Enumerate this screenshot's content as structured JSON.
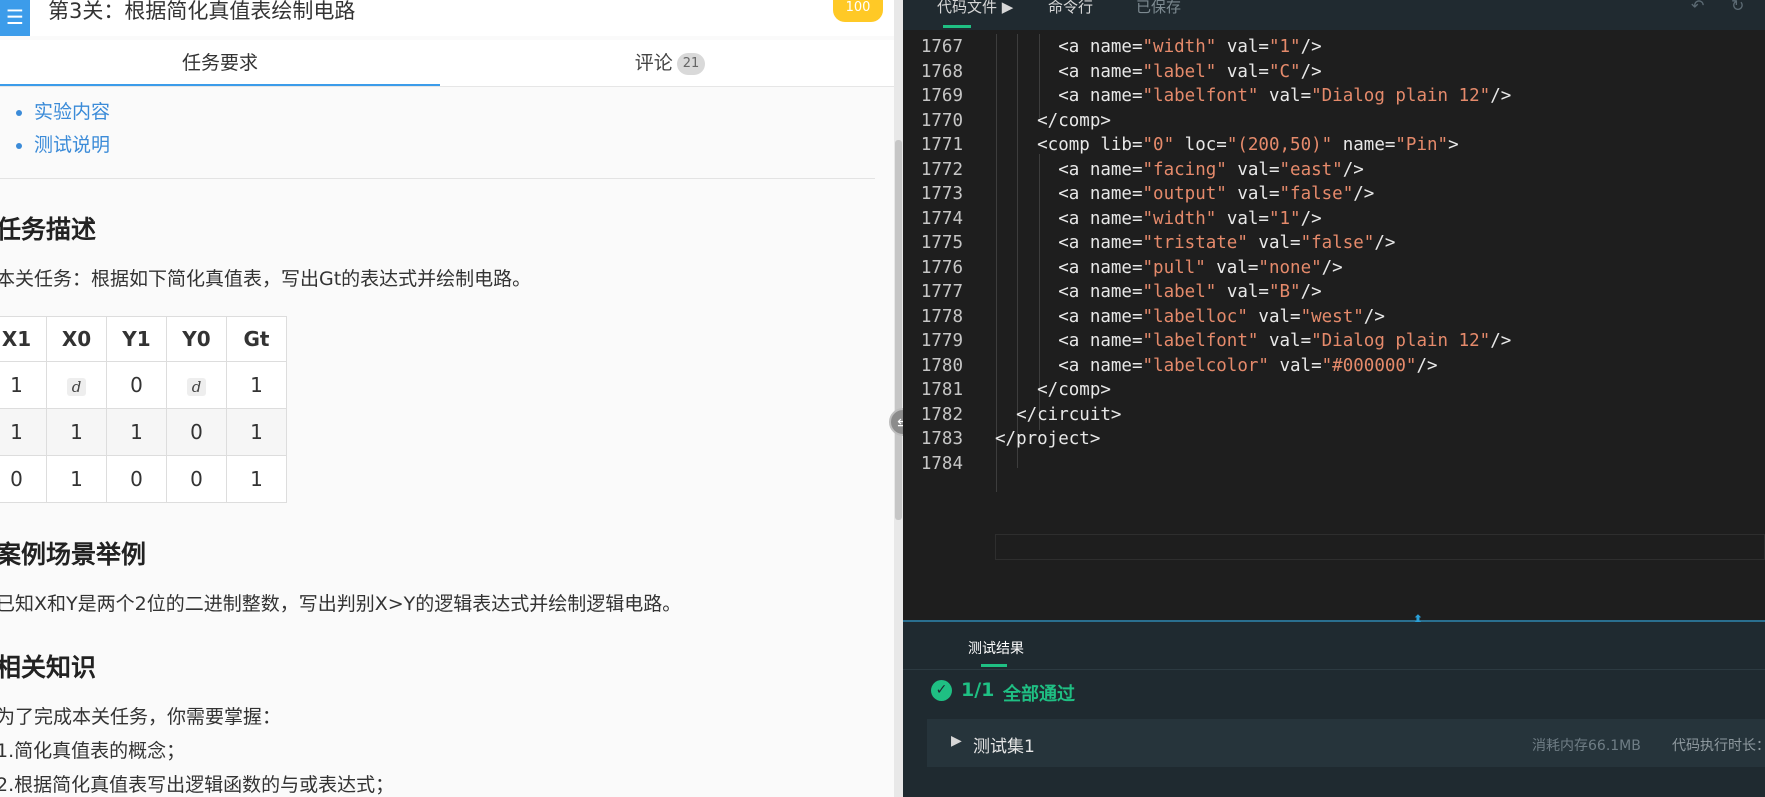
{
  "header": {
    "menu_icon": "hamburger-icon",
    "title": "第3关：根据简化真值表绘制电路",
    "score": "100"
  },
  "tabs": {
    "task_label": "任务要求",
    "comments_label": "评论",
    "comments_count": "21"
  },
  "toc": [
    "实验内容",
    "测试说明"
  ],
  "sections": {
    "task_heading": "任务描述",
    "task_text": "本关任务：根据如下简化真值表，写出Gt的表达式并绘制电路。",
    "example_heading": "案例场景举例",
    "example_text": "已知X和Y是两个2位的二进制整数，写出判别X>Y的逻辑表达式并绘制逻辑电路。",
    "knowledge_heading": "相关知识",
    "knowledge_intro": "为了完成本关任务，你需要掌握：",
    "knowledge_item1": "1.简化真值表的概念；",
    "knowledge_item2": "2.根据简化真值表写出逻辑函数的与或表达式；"
  },
  "truth_table": {
    "headers": [
      "X1",
      "X0",
      "Y1",
      "Y0",
      "Gt"
    ],
    "rows": [
      [
        "1",
        "d",
        "0",
        "d",
        "1"
      ],
      [
        "1",
        "1",
        "1",
        "0",
        "1"
      ],
      [
        "0",
        "1",
        "0",
        "0",
        "1"
      ]
    ]
  },
  "editor": {
    "tab_code": "代码文件 ▶",
    "tab_cmd": "命令行",
    "saved_status": "已保存",
    "undo_icon": "undo-icon",
    "refresh_icon": "refresh-icon",
    "lines": [
      {
        "n": "1767",
        "code": "      <a name=\"width\" val=\"1\"/>"
      },
      {
        "n": "1768",
        "code": "      <a name=\"label\" val=\"C\"/>"
      },
      {
        "n": "1769",
        "code": "      <a name=\"labelfont\" val=\"Dialog plain 12\"/>"
      },
      {
        "n": "1770",
        "code": "    </comp>"
      },
      {
        "n": "1771",
        "code": "    <comp lib=\"0\" loc=\"(200,50)\" name=\"Pin\">"
      },
      {
        "n": "1772",
        "code": "      <a name=\"facing\" val=\"east\"/>"
      },
      {
        "n": "1773",
        "code": "      <a name=\"output\" val=\"false\"/>"
      },
      {
        "n": "1774",
        "code": "      <a name=\"width\" val=\"1\"/>"
      },
      {
        "n": "1775",
        "code": "      <a name=\"tristate\" val=\"false\"/>"
      },
      {
        "n": "1776",
        "code": "      <a name=\"pull\" val=\"none\"/>"
      },
      {
        "n": "1777",
        "code": "      <a name=\"label\" val=\"B\"/>"
      },
      {
        "n": "1778",
        "code": "      <a name=\"labelloc\" val=\"west\"/>"
      },
      {
        "n": "1779",
        "code": "      <a name=\"labelfont\" val=\"Dialog plain 12\"/>"
      },
      {
        "n": "1780",
        "code": "      <a name=\"labelcolor\" val=\"#000000\"/>"
      },
      {
        "n": "1781",
        "code": "    </comp>"
      },
      {
        "n": "1782",
        "code": "  </circuit>"
      },
      {
        "n": "1783",
        "code": "</project>"
      },
      {
        "n": "1784",
        "code": ""
      }
    ]
  },
  "results": {
    "tab_label": "测试结果",
    "pass_count": "1/1",
    "pass_text": "全部通过",
    "suite_name": "测试集1",
    "memory": "消耗内存66.1MB",
    "time_label": "代码执行时长："
  },
  "colors": {
    "accent_blue": "#3c9cea",
    "success_green": "#1fbf83",
    "string_orange": "#e58a6b",
    "badge_yellow": "#ffc926"
  }
}
